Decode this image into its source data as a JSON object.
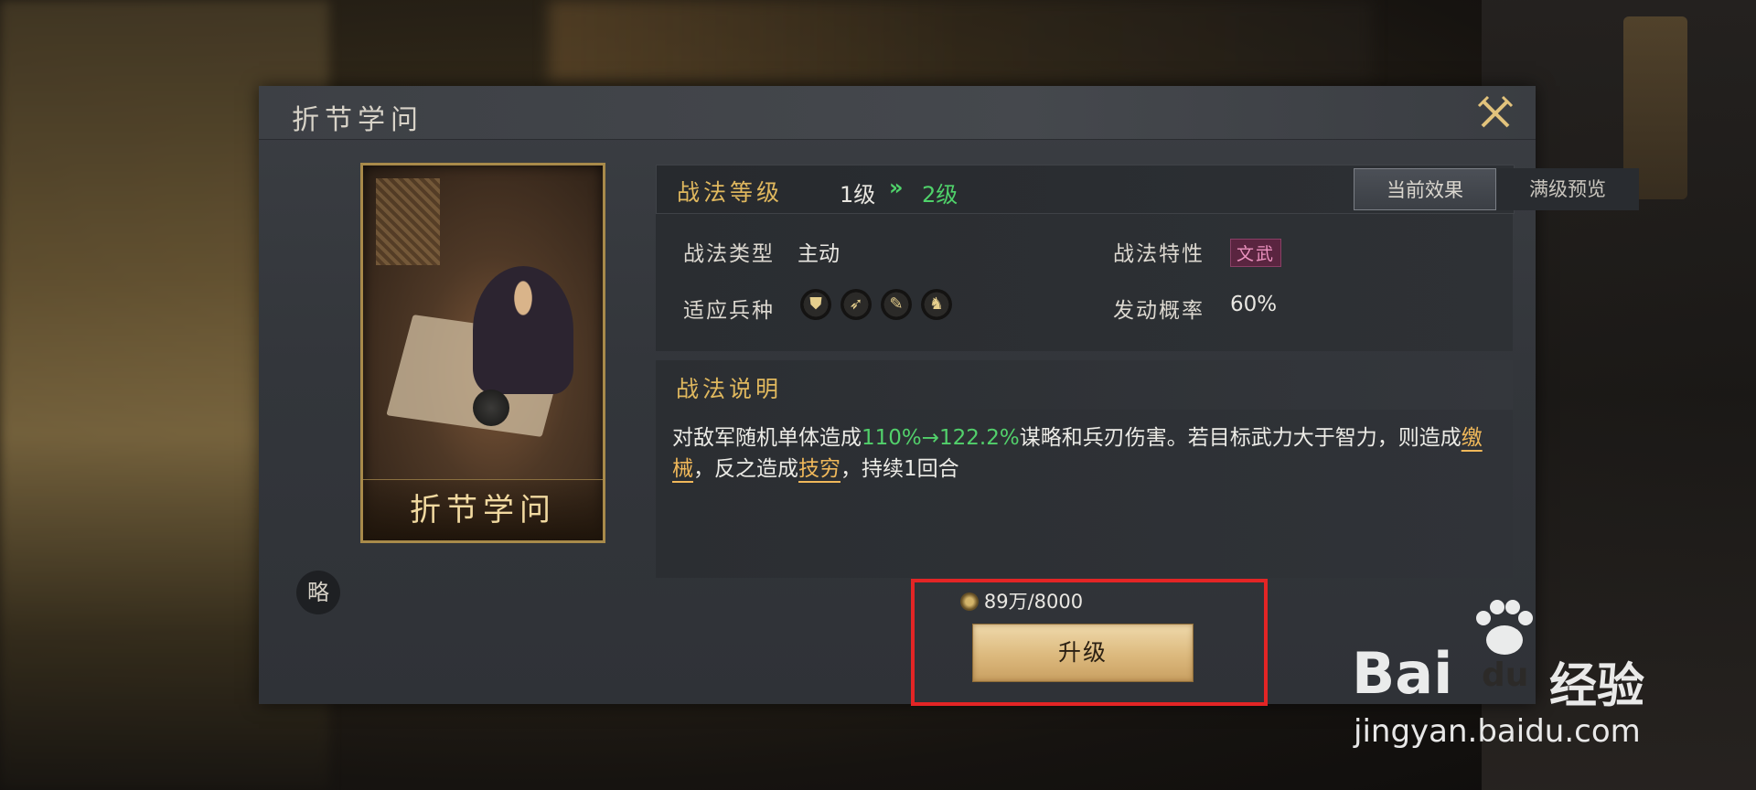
{
  "dialog": {
    "title": "折节学问",
    "close_icon": "crossed-swords-close-icon"
  },
  "card": {
    "name": "折节学问"
  },
  "strategy_badge": "略",
  "level": {
    "label": "战法等级",
    "from": "1级",
    "arrows": "»",
    "to": "2级"
  },
  "tabs": [
    {
      "label": "当前效果",
      "active": true
    },
    {
      "label": "满级预览",
      "active": false
    }
  ],
  "info": {
    "type_label": "战法类型",
    "type_value": "主动",
    "trait_label": "战法特性",
    "trait_value": "文武",
    "units_label": "适应兵种",
    "unit_icons": [
      "shield-icon",
      "bow-icon",
      "spear-icon",
      "horse-icon"
    ],
    "unit_glyphs": [
      "⛊",
      "➶",
      "✎",
      "♞"
    ],
    "rate_label": "发动概率",
    "rate_value": "60%"
  },
  "description": {
    "title": "战法说明",
    "part1": "对敌军随机单体造成",
    "highlight": "110%→122.2%",
    "part2": "谋略和兵刃伤害。若目标武力大于智力，则造成",
    "term1": "缴械",
    "part3": "，反之造成",
    "term2": "技穷",
    "part4": "，持续1回合"
  },
  "upgrade": {
    "cost": "89万/8000",
    "button_label": "升级"
  },
  "watermark": {
    "brand_left": "Bai",
    "brand_mid": "du",
    "brand_cn": "经验",
    "url": "jingyan.baidu.com"
  },
  "colors": {
    "accent_gold": "#e0b85e",
    "level_green": "#4fd26a",
    "term_orange": "#f0b85a",
    "highlight_red": "#e32525"
  }
}
